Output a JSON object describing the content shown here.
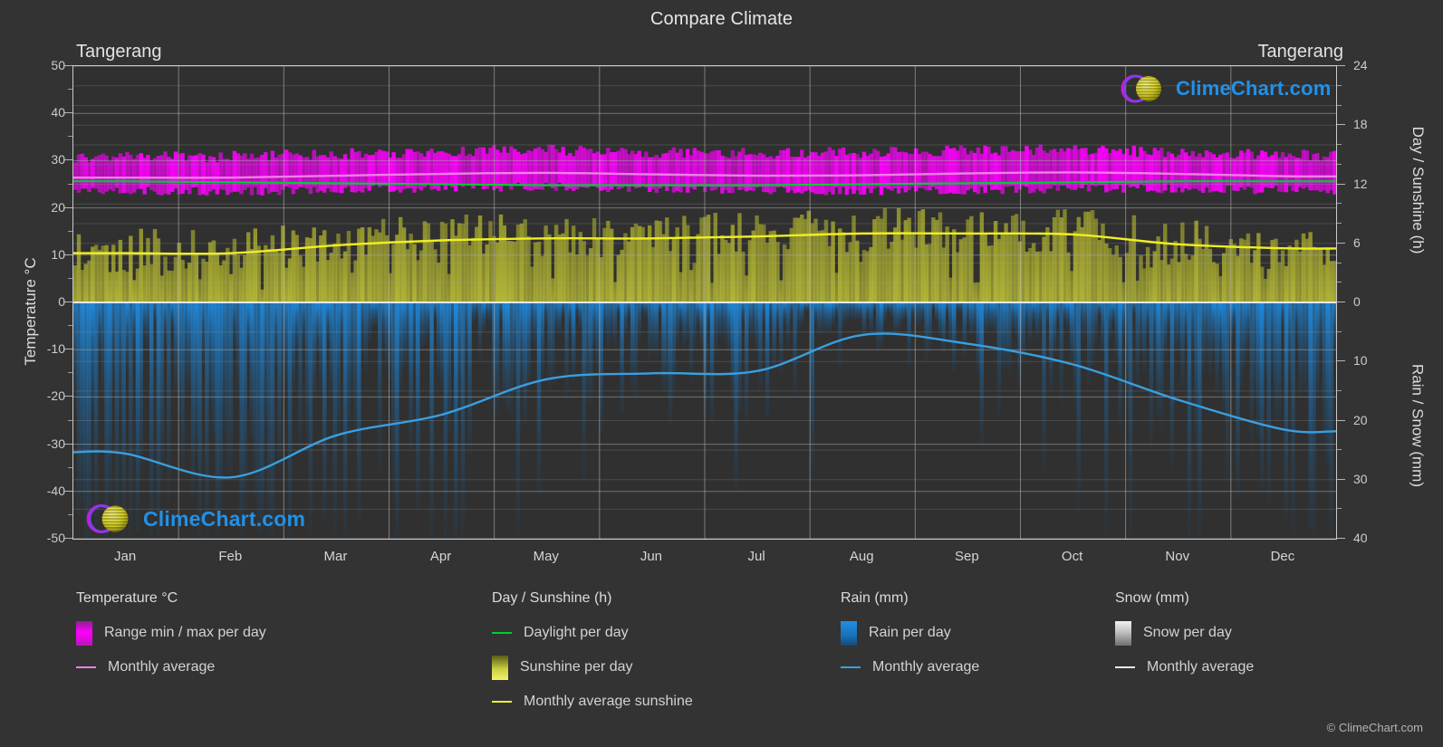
{
  "header": {
    "title": "Compare Climate",
    "location_left": "Tangerang",
    "location_right": "Tangerang"
  },
  "branding": {
    "logo_text": "ClimeChart.com",
    "copyright": "© ClimeChart.com"
  },
  "axes": {
    "left_title": "Temperature °C",
    "right_top_title": "Day / Sunshine (h)",
    "right_bottom_title": "Rain / Snow (mm)",
    "left_ticks": [
      "50",
      "40",
      "30",
      "20",
      "10",
      "0",
      "-10",
      "-20",
      "-30",
      "-40",
      "-50"
    ],
    "right_top_ticks": [
      "24",
      "18",
      "12",
      "6",
      "0"
    ],
    "right_bottom_ticks": [
      "0",
      "10",
      "20",
      "30",
      "40"
    ],
    "x_ticks": [
      "Jan",
      "Feb",
      "Mar",
      "Apr",
      "May",
      "Jun",
      "Jul",
      "Aug",
      "Sep",
      "Oct",
      "Nov",
      "Dec"
    ]
  },
  "legend": {
    "temperature": {
      "heading": "Temperature °C",
      "items": [
        {
          "label": "Range min / max per day",
          "marker": "gradient-swatch",
          "color": "#ff00ff"
        },
        {
          "label": "Monthly average",
          "marker": "line",
          "color": "#ef7fe8"
        }
      ]
    },
    "day_sunshine": {
      "heading": "Day / Sunshine (h)",
      "items": [
        {
          "label": "Daylight per day",
          "marker": "line",
          "color": "#00cc33"
        },
        {
          "label": "Sunshine per day",
          "marker": "gradient-swatch",
          "color": "#d8dc45"
        },
        {
          "label": "Monthly average sunshine",
          "marker": "line",
          "color": "#efef22"
        }
      ]
    },
    "rain": {
      "heading": "Rain (mm)",
      "items": [
        {
          "label": "Rain per day",
          "marker": "gradient-swatch",
          "color": "#1f90e8"
        },
        {
          "label": "Monthly average",
          "marker": "line",
          "color": "#3a9fe0"
        }
      ]
    },
    "snow": {
      "heading": "Snow (mm)",
      "items": [
        {
          "label": "Snow per day",
          "marker": "gradient-swatch",
          "color": "#c8c8c8"
        },
        {
          "label": "Monthly average",
          "marker": "line",
          "color": "#e9e9e9"
        }
      ]
    }
  },
  "chart_data": {
    "type": "area",
    "title": "Compare Climate",
    "subtitle": "Tangerang",
    "xlabel": "",
    "ylabel": "Temperature °C",
    "categories": [
      "Jan",
      "Feb",
      "Mar",
      "Apr",
      "May",
      "Jun",
      "Jul",
      "Aug",
      "Sep",
      "Oct",
      "Nov",
      "Dec"
    ],
    "axes": {
      "left": {
        "label": "Temperature °C",
        "min": -50,
        "max": 50,
        "ticks": [
          50,
          40,
          30,
          20,
          10,
          0,
          -10,
          -20,
          -30,
          -40,
          -50
        ]
      },
      "right_top": {
        "label": "Day / Sunshine (h)",
        "min": 0,
        "max": 24,
        "ticks": [
          0,
          6,
          12,
          18,
          24
        ]
      },
      "right_bottom": {
        "label": "Rain / Snow (mm)",
        "min": 0,
        "max": 40,
        "ticks": [
          0,
          10,
          20,
          30,
          40
        ]
      }
    },
    "grid": true,
    "legend_position": "bottom",
    "series": [
      {
        "name": "Range min / max per day",
        "type": "band",
        "unit": "°C",
        "axis": "left",
        "color": "#ff00ff",
        "min_values": [
          23.5,
          23.5,
          23.8,
          24.2,
          24.4,
          24.0,
          23.6,
          23.6,
          23.8,
          24.0,
          24.0,
          23.8
        ],
        "max_values": [
          30.8,
          30.9,
          31.4,
          32.0,
          32.2,
          31.8,
          31.6,
          31.8,
          32.2,
          32.2,
          31.8,
          31.2
        ]
      },
      {
        "name": "Monthly average",
        "type": "line",
        "unit": "°C",
        "axis": "left",
        "color": "#ef7fe8",
        "values": [
          26.4,
          26.4,
          26.8,
          27.2,
          27.4,
          27.1,
          26.8,
          26.9,
          27.3,
          27.5,
          27.2,
          26.7
        ]
      },
      {
        "name": "Daylight per day",
        "type": "line",
        "unit": "h",
        "axis": "right_top",
        "color": "#00cc33",
        "values": [
          12.3,
          12.2,
          12.1,
          12.0,
          11.9,
          11.9,
          11.9,
          12.0,
          12.1,
          12.2,
          12.3,
          12.3
        ]
      },
      {
        "name": "Monthly average sunshine",
        "type": "line",
        "unit": "h",
        "axis": "right_top",
        "color": "#efef22",
        "values": [
          5.0,
          5.0,
          5.8,
          6.3,
          6.5,
          6.5,
          6.7,
          7.0,
          7.0,
          6.9,
          5.9,
          5.5
        ]
      },
      {
        "name": "Sunshine per day",
        "type": "area",
        "unit": "h",
        "axis": "right_top",
        "color": "#d8dc45",
        "values": [
          5.0,
          5.0,
          5.8,
          6.3,
          6.5,
          6.5,
          6.7,
          7.0,
          7.0,
          6.9,
          5.9,
          5.5
        ]
      },
      {
        "name": "Rain monthly average",
        "type": "line",
        "unit": "mm",
        "axis": "right_bottom",
        "color": "#3a9fe0",
        "values": [
          25.6,
          29.6,
          22.5,
          19.0,
          13.0,
          12.0,
          11.6,
          5.5,
          7.0,
          10.5,
          16.5,
          21.5
        ]
      },
      {
        "name": "Rain per day",
        "type": "area",
        "unit": "mm",
        "axis": "right_bottom",
        "color": "#1f90e8",
        "values": [
          25.6,
          29.6,
          22.5,
          19.0,
          13.0,
          12.0,
          11.6,
          5.5,
          7.0,
          10.5,
          16.5,
          21.5
        ]
      },
      {
        "name": "Snow per day",
        "type": "area",
        "unit": "mm",
        "axis": "right_bottom",
        "color": "#c8c8c8",
        "values": [
          0,
          0,
          0,
          0,
          0,
          0,
          0,
          0,
          0,
          0,
          0,
          0
        ]
      }
    ]
  },
  "colors": {
    "background": "#333333",
    "plot_background": "#303030",
    "grid": "#9a9a9a",
    "text": "#d8d8d8",
    "temperature": "#ff00ff",
    "temperature_avg": "#ef7fe8",
    "daylight": "#00cc33",
    "sunshine": "#d8dc45",
    "sunshine_avg": "#efef22",
    "rain": "#1f90e8",
    "rain_avg": "#3a9fe0",
    "snow": "#c8c8c8",
    "logo_blue": "#2291e8"
  }
}
